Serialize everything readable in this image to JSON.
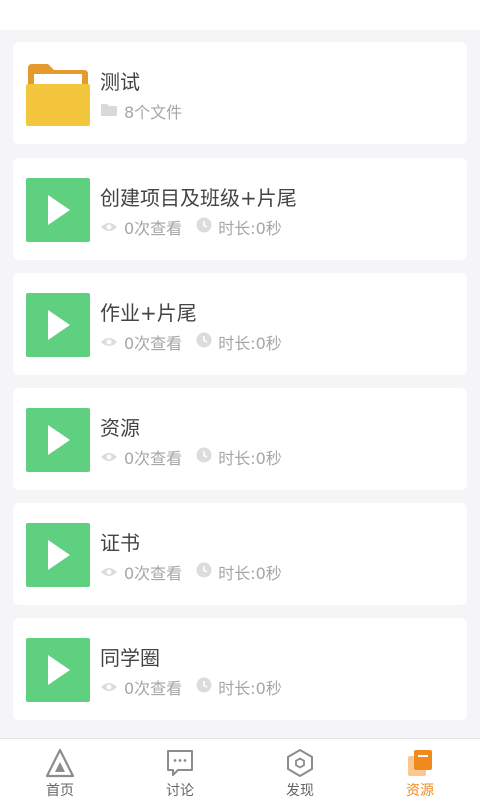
{
  "items": [
    {
      "type": "folder",
      "title": "测试",
      "file_count": "8个文件"
    },
    {
      "type": "video",
      "title": "创建项目及班级+片尾",
      "views": "0次查看",
      "duration": "时长:0秒"
    },
    {
      "type": "video",
      "title": "作业+片尾",
      "views": "0次查看",
      "duration": "时长:0秒"
    },
    {
      "type": "video",
      "title": "资源",
      "views": "0次查看",
      "duration": "时长:0秒"
    },
    {
      "type": "video",
      "title": "证书",
      "views": "0次查看",
      "duration": "时长:0秒"
    },
    {
      "type": "video",
      "title": "同学圈",
      "views": "0次查看",
      "duration": "时长:0秒"
    }
  ],
  "tabs": [
    {
      "label": "首页",
      "icon": "home-triangle-icon"
    },
    {
      "label": "讨论",
      "icon": "chat-icon"
    },
    {
      "label": "发现",
      "icon": "hexagon-discover-icon"
    },
    {
      "label": "资源",
      "icon": "resource-icon",
      "active": true
    }
  ],
  "colors": {
    "accent": "#f08a1d",
    "video_thumb": "#5fcf80",
    "folder": "#f4c63d",
    "background": "#f5f5f7"
  }
}
